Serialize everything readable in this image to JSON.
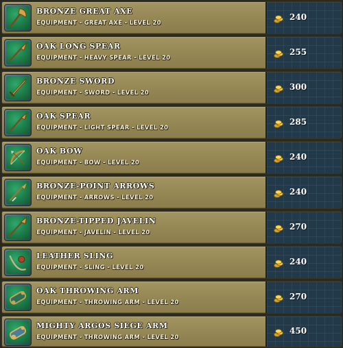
{
  "items": [
    {
      "name": "BRONZE GREAT AXE",
      "category": "EQUIPMENT",
      "type": "GREAT AXE",
      "level": "LEVEL 20",
      "price": "240",
      "icon": "great-axe-icon"
    },
    {
      "name": "OAK LONG SPEAR",
      "category": "EQUIPMENT",
      "type": "HEAVY SPEAR",
      "level": "LEVEL 20",
      "price": "255",
      "icon": "long-spear-icon"
    },
    {
      "name": "BRONZE SWORD",
      "category": "EQUIPMENT",
      "type": "SWORD",
      "level": "LEVEL 20",
      "price": "300",
      "icon": "sword-icon"
    },
    {
      "name": "OAK SPEAR",
      "category": "EQUIPMENT",
      "type": "LIGHT SPEAR",
      "level": "LEVEL 20",
      "price": "285",
      "icon": "spear-icon"
    },
    {
      "name": "OAK BOW",
      "category": "EQUIPMENT",
      "type": "BOW",
      "level": "LEVEL 20",
      "price": "240",
      "icon": "bow-icon"
    },
    {
      "name": "BRONZE-POINT ARROWS",
      "category": "EQUIPMENT",
      "type": "ARROWS",
      "level": "LEVEL 20",
      "price": "240",
      "icon": "arrows-icon"
    },
    {
      "name": "BRONZE-TIPPED JAVELIN",
      "category": "EQUIPMENT",
      "type": "JAVELIN",
      "level": "LEVEL 20",
      "price": "270",
      "icon": "javelin-icon"
    },
    {
      "name": "LEATHER SLING",
      "category": "EQUIPMENT",
      "type": "SLING",
      "level": "LEVEL 20",
      "price": "240",
      "icon": "sling-icon"
    },
    {
      "name": "OAK THROWING ARM",
      "category": "EQUIPMENT",
      "type": "THROWING ARM",
      "level": "LEVEL 20",
      "price": "270",
      "icon": "throwing-arm-icon"
    },
    {
      "name": "MIGHTY ARGOS SIEGE ARM",
      "category": "EQUIPMENT",
      "type": "THROWING ARM",
      "level": "LEVEL 20",
      "price": "450",
      "icon": "siege-arm-icon"
    }
  ],
  "separator": " - ",
  "currency_icon": "gold-coins-icon",
  "colors": {
    "row_bg": "#978956",
    "price_bg": "#22394a",
    "icon_bg": "#1d7d4a",
    "text": "#ffffff"
  }
}
